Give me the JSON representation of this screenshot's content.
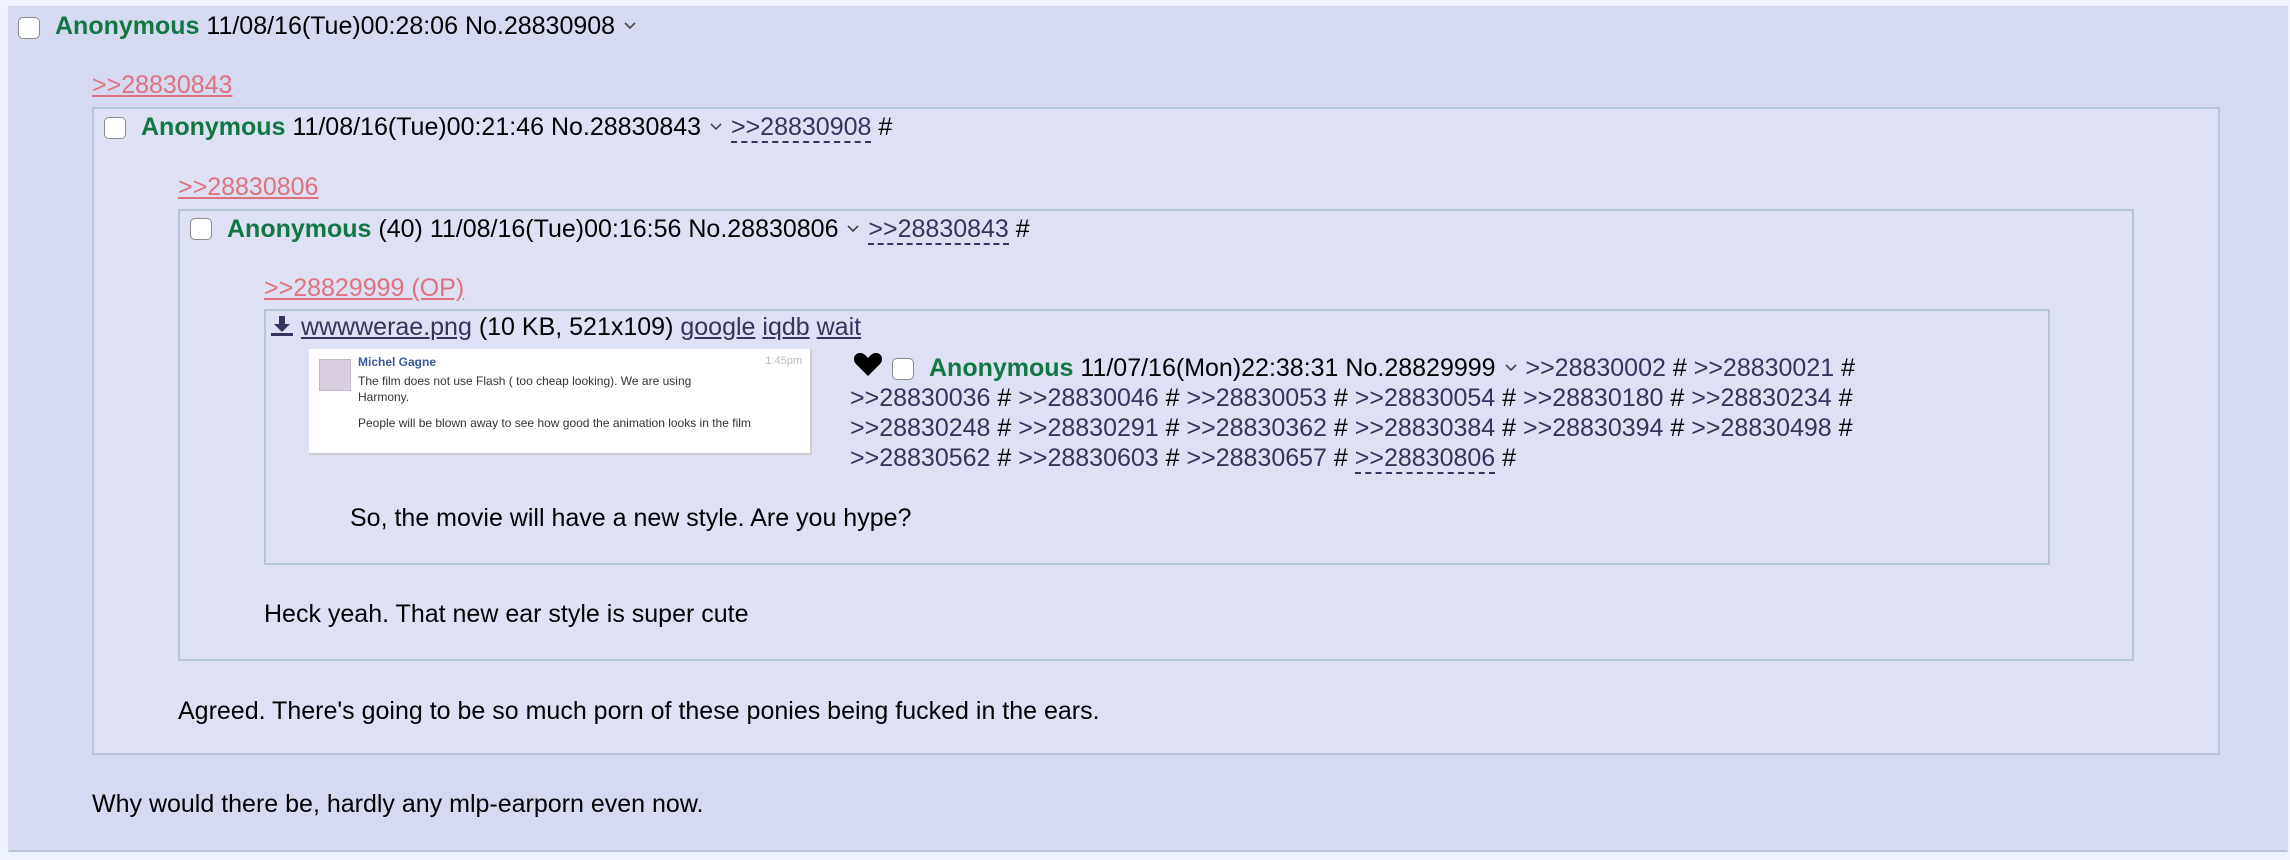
{
  "outer_post": {
    "name": "Anonymous",
    "datetime": "11/08/16(Tue)00:28:06",
    "number": "No.28830908",
    "quote": ">>28830843",
    "comment": "Why would there be, hardly any mlp-earporn even now."
  },
  "post_l1": {
    "name": "Anonymous",
    "datetime": "11/08/16(Tue)00:21:46",
    "number": "No.28830843",
    "backlinks": [
      ">>28830908"
    ],
    "quote": ">>28830806",
    "comment": "Agreed. There's going to be so much porn of these ponies being fucked in the ears."
  },
  "post_l2": {
    "name": "Anonymous",
    "count": "(40)",
    "datetime": "11/08/16(Tue)00:16:56",
    "number": "No.28830806",
    "backlinks": [
      ">>28830843"
    ],
    "quote": ">>28829999 (OP)",
    "comment": "Heck yeah. That new ear style is super cute"
  },
  "op_post": {
    "file": {
      "icon": "download-icon",
      "name": "wwwwerae.png",
      "info": "(10 KB, 521x109)",
      "links": [
        "google",
        "iqdb",
        "wait"
      ]
    },
    "thumbnail": {
      "author": "Michel Gagne",
      "time": "1:45pm",
      "text1": "The film does not use Flash ( too cheap looking). We are using Harmony.",
      "text2": "People will be blown away to see how good the animation looks in the film"
    },
    "heart_icon": "heart-icon",
    "name": "Anonymous",
    "datetime": "11/07/16(Mon)22:38:31",
    "number": "No.28829999",
    "backlinks": [
      ">>28830002",
      ">>28830021",
      ">>28830036",
      ">>28830046",
      ">>28830053",
      ">>28830054",
      ">>28830180",
      ">>28830234",
      ">>28830248",
      ">>28830291",
      ">>28830362",
      ">>28830384",
      ">>28830394",
      ">>28830498",
      ">>28830562",
      ">>28830603",
      ">>28830657",
      ">>28830806"
    ],
    "comment": "So, the movie will have a new style. Are you hype?"
  },
  "hash": "#",
  "colors": {
    "name": "#117743",
    "quotelink": "#e0727f",
    "link": "#34345c",
    "post_bg": "#d6daf0",
    "border": "#b7c5d9"
  }
}
